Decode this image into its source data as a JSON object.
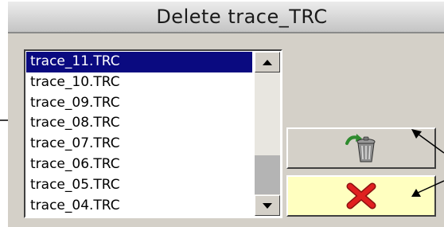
{
  "dialog": {
    "title": "Delete trace_TRC"
  },
  "file_list": {
    "items": [
      "trace_11.TRC",
      "trace_10.TRC",
      "trace_09.TRC",
      "trace_08.TRC",
      "trace_07.TRC",
      "trace_06.TRC",
      "trace_05.TRC",
      "trace_04.TRC"
    ],
    "selected": "trace_11.TRC"
  },
  "buttons": {
    "delete": {
      "icon": "trash-can-icon"
    },
    "cancel": {
      "icon": "red-x-icon"
    }
  },
  "colors": {
    "selection": "#0a0a80",
    "cancel_button_bg": "#ffffc0",
    "dialog_bg": "#d4d0c8"
  }
}
